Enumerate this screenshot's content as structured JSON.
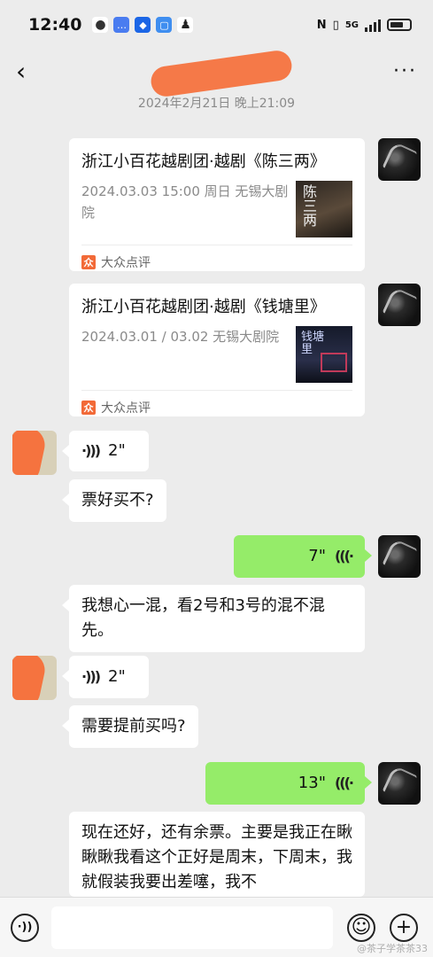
{
  "status_bar": {
    "time": "12:40",
    "network": "5G"
  },
  "nav": {
    "back_icon": "‹",
    "more_icon": "···"
  },
  "timestamp": "2024年2月21日 晚上21:09",
  "cards": [
    {
      "title": "浙江小百花越剧团·越剧《陈三两》",
      "desc": "2024.03.03 15:00 周日 无锡大剧院",
      "thumb_text": "陈三两",
      "source": "大众点评"
    },
    {
      "title": "浙江小百花越剧团·越剧《钱塘里》",
      "desc": "2024.03.01 / 03.02 无锡大剧院",
      "thumb_text": "钱塘里",
      "source": "大众点评"
    }
  ],
  "messages": {
    "voice1": "2\"",
    "text1": "票好买不?",
    "voice_out1": "7\"",
    "text2": "我想心一混，看2号和3号的混不混先。",
    "voice2": "2\"",
    "text3": "需要提前买吗?",
    "voice_out2": "13\"",
    "text4": "现在还好，还有余票。主要是我正在瞅瞅瞅我看这个正好是周末，下周末，我就假装我要出差噻，我不"
  },
  "watermark": "@茶子学茶茶33",
  "colors": {
    "background": "#ececec",
    "out_bubble": "#95ec69",
    "in_bubble": "#ffffff",
    "dianping": "#f26a38"
  }
}
